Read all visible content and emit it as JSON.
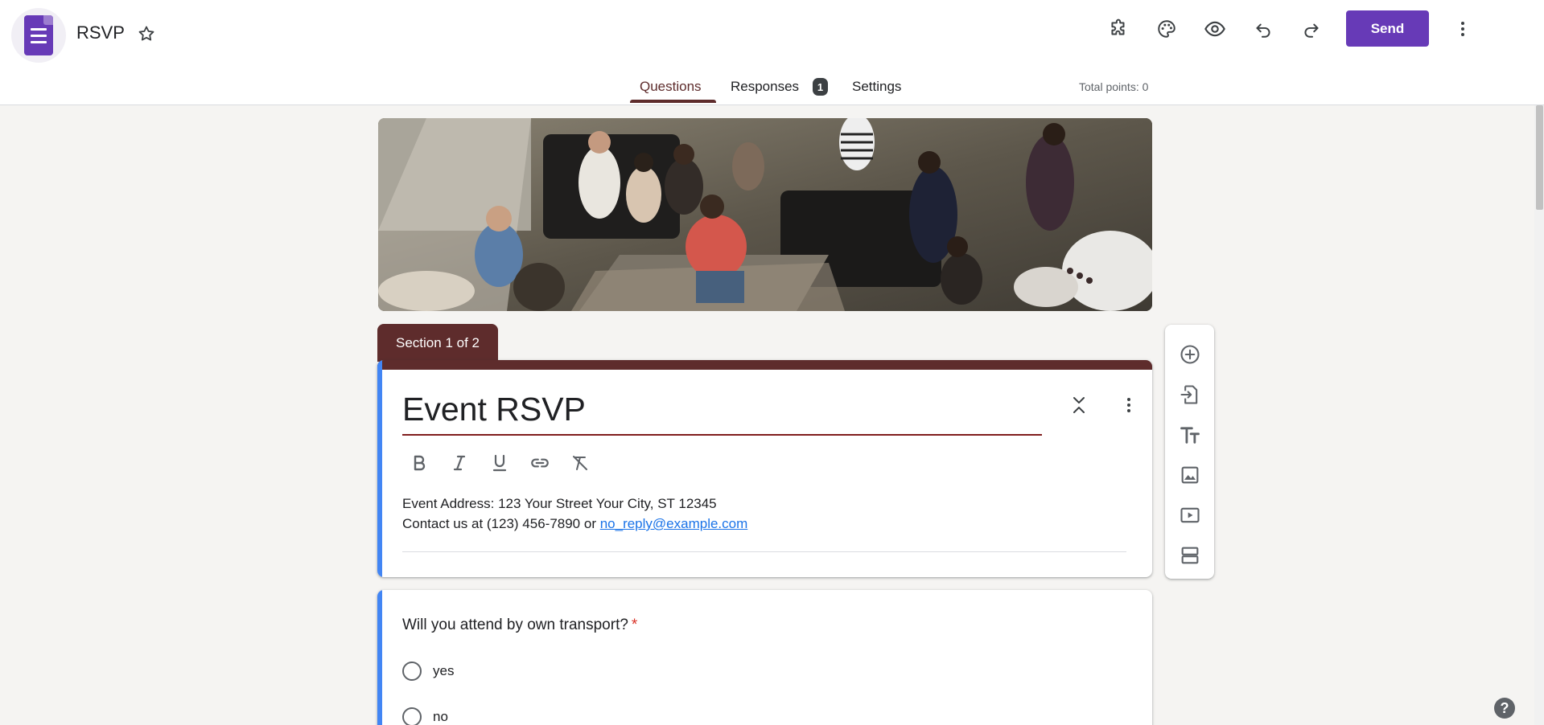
{
  "app": {
    "title": "RSVP",
    "send_label": "Send"
  },
  "tabs": {
    "questions": "Questions",
    "responses": "Responses",
    "responses_badge": "1",
    "settings": "Settings"
  },
  "total_points": "Total points: 0",
  "section_label": "Section 1 of 2",
  "form": {
    "title": "Event RSVP",
    "description_line1": "Event Address: 123 Your Street Your City, ST 12345",
    "description_line2_prefix": "Contact us at (123) 456-7890 or ",
    "description_email": "no_reply@example.com"
  },
  "question": {
    "title": "Will you attend by own transport?",
    "required_mark": "*",
    "options": [
      "yes",
      "no"
    ]
  },
  "help_label": "?",
  "colors": {
    "accent": "#673ab7",
    "theme": "#5e2c2c",
    "focus_bar": "#4285f4",
    "link": "#1a73e8"
  }
}
